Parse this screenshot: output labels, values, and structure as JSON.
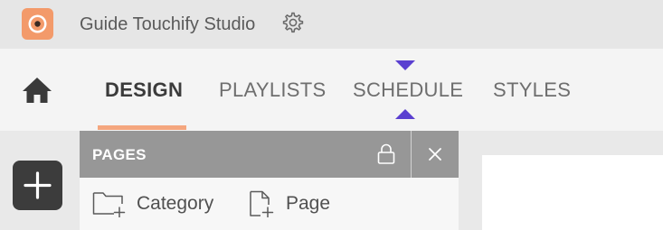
{
  "app": {
    "name": "Guide Touchify Studio",
    "logo_icon": "touchify-logo-icon",
    "settings_icon": "gear-icon"
  },
  "nav": {
    "home_icon": "home-icon",
    "tabs": [
      {
        "label": "DESIGN",
        "active": true
      },
      {
        "label": "PLAYLISTS",
        "active": false
      },
      {
        "label": "SCHEDULE",
        "active": false
      },
      {
        "label": "STYLES",
        "active": false
      }
    ],
    "active_underline_color": "#f4a67e",
    "marker_color": "#5a3fd0"
  },
  "toolbar": {
    "add_icon": "plus-icon"
  },
  "pages_panel": {
    "title": "PAGES",
    "lock_icon": "lock-icon",
    "close_icon": "close-icon",
    "actions": [
      {
        "label": "Category",
        "icon": "folder-plus-icon"
      },
      {
        "label": "Page",
        "icon": "file-plus-icon"
      }
    ]
  },
  "colors": {
    "brand": "#f39a6a",
    "panel_header": "#979797"
  }
}
